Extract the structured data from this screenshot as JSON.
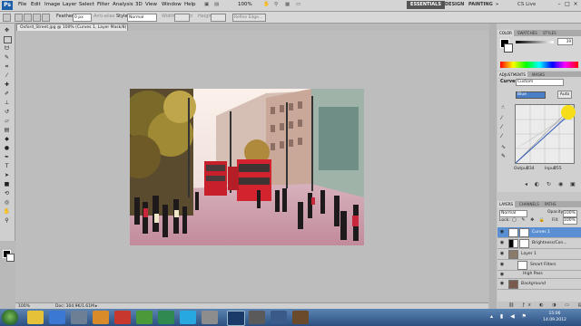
{
  "menubar": {
    "logo": "Ps",
    "items": [
      "File",
      "Edit",
      "Image",
      "Layer",
      "Select",
      "Filter",
      "Analysis",
      "3D",
      "View",
      "Window",
      "Help"
    ],
    "zoom": "100%",
    "workspaces": [
      "ESSENTIALS",
      "DESIGN",
      "PAINTING"
    ],
    "cs_live": "CS Live"
  },
  "options": {
    "feather_label": "Feather:",
    "feather_value": "0 px",
    "antialias_label": "Anti-alias",
    "style_label": "Style:",
    "style_value": "Normal",
    "width_label": "Width:",
    "height_label": "Height:",
    "refine_label": "Refine Edge..."
  },
  "document": {
    "tab_title": "Oxford_Street.jpg @ 100% (Curves 1, Layer Mask/8) *"
  },
  "status": {
    "zoom": "100%",
    "doc": "Doc: 304.9K/1.61M"
  },
  "color_panel": {
    "tabs": [
      "COLOR",
      "SWATCHES",
      "STYLES"
    ],
    "value": "39"
  },
  "adjustments": {
    "tabs": [
      "ADJUSTMENTS",
      "MASKS"
    ],
    "title": "Curves",
    "preset": "Custom",
    "channel": "Blue",
    "auto_label": "Auto",
    "output_label": "Output:",
    "output_value": "234",
    "input_label": "Input:",
    "input_value": "255"
  },
  "layers": {
    "tabs": [
      "LAYERS",
      "CHANNELS",
      "PATHS"
    ],
    "blend_mode": "Normal",
    "opacity_label": "Opacity:",
    "opacity_value": "100%",
    "lock_label": "Lock:",
    "fill_label": "Fill:",
    "fill_value": "100%",
    "rows": [
      {
        "name": "Curves 1",
        "selected": true
      },
      {
        "name": "Brightness/Con...",
        "selected": false
      },
      {
        "name": "Layer 1",
        "selected": false
      },
      {
        "name": "Smart Filters",
        "selected": false
      },
      {
        "name": "High Pass",
        "selected": false
      },
      {
        "name": "Background",
        "selected": false
      }
    ]
  },
  "taskbar": {
    "time": "15:06",
    "date": "14.09.2012"
  }
}
